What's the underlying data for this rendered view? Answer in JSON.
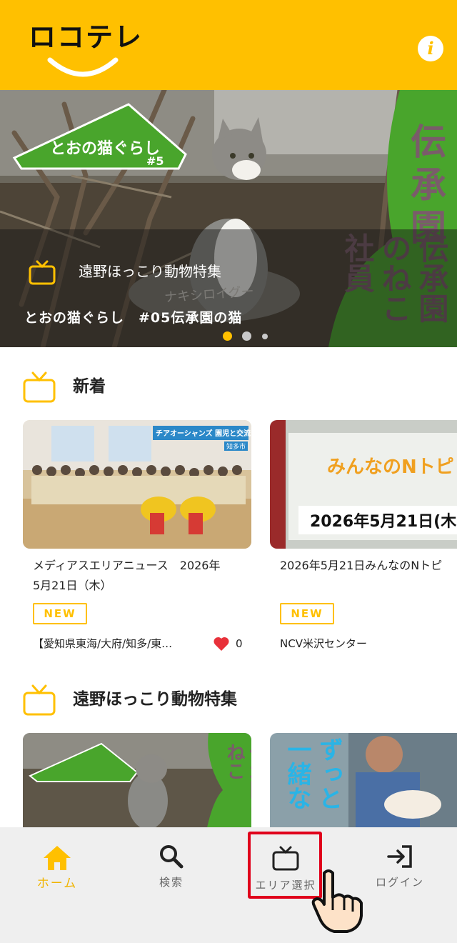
{
  "app": {
    "logo_text": "ロコテレ",
    "info_glyph": "i"
  },
  "hero": {
    "category": "遠野ほっこり動物特集",
    "title": "とおの猫ぐらし　#05伝承園の猫",
    "badge_text": "とおの猫ぐらし",
    "badge_num": "#5",
    "side_text": "伝承園のねこ社員",
    "stone_text": "ナキシロイグー",
    "dots_total": 3,
    "dots_active": 1
  },
  "sections": [
    {
      "title": "新着",
      "cards": [
        {
          "title": "メディアスエリアニュース　2026年\n5月21日（木）",
          "badge": "NEW",
          "sub": "【愛知県東海/大府/知多/東…",
          "likes": "0",
          "thumb_caption": "チアオーシャンズ 園児と交流",
          "thumb_caption2": "知多市"
        },
        {
          "title": "2026年5月21日みんなのNトピ",
          "badge": "NEW",
          "sub": "NCV米沢センター",
          "thumb_logo": "みんなのNトピ",
          "thumb_date": "2026年5月21日(木"
        }
      ]
    },
    {
      "title": "遠野ほっこり動物特集",
      "cards": [
        {
          "thumb_text": "伝承園のねこ"
        },
        {
          "thumb_text": "ずっと一緒な"
        }
      ]
    }
  ],
  "nav": {
    "items": [
      {
        "label": "ホーム",
        "icon": "home-icon",
        "active": true
      },
      {
        "label": "検索",
        "icon": "search-icon",
        "active": false
      },
      {
        "label": "エリア選択",
        "icon": "tv-icon",
        "active": false
      },
      {
        "label": "ログイン",
        "icon": "login-icon",
        "active": false
      }
    ]
  },
  "colors": {
    "accent": "#ffc000",
    "highlight": "#e0001b",
    "like": "#e8313a"
  }
}
